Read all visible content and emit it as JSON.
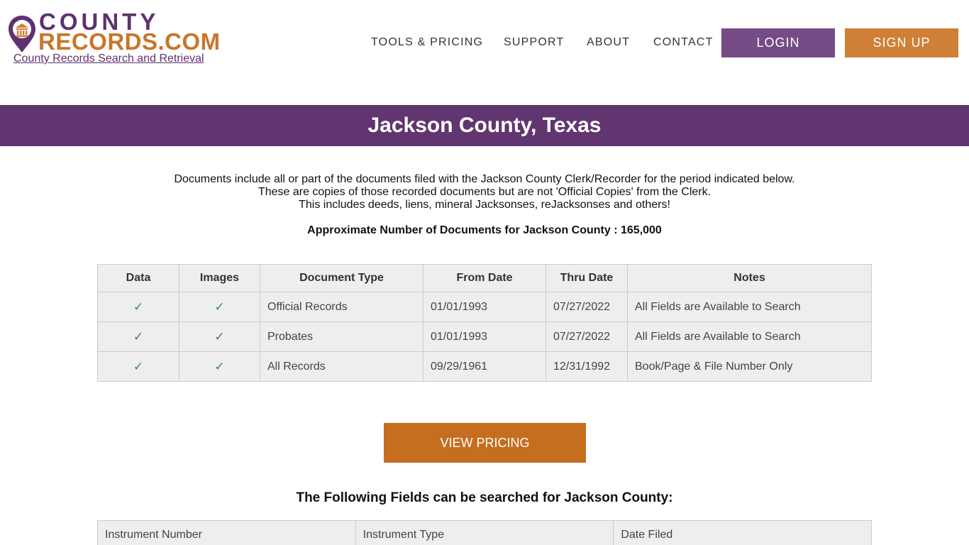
{
  "header": {
    "logo": {
      "word1": "COUNTY",
      "word2": "RECORDS.COM",
      "tagline": "County Records Search and Retrieval"
    },
    "nav": [
      {
        "label": "TOOLS & PRICING"
      },
      {
        "label": "SUPPORT"
      },
      {
        "label": "ABOUT"
      },
      {
        "label": "CONTACT"
      }
    ],
    "login_label": "LOGIN",
    "signup_label": "SIGN UP"
  },
  "colors": {
    "brand_purple": "#613570",
    "brand_orange": "#c8762a",
    "login_bg": "#764c87",
    "signup_bg": "#d07f36",
    "pricing_bg": "#c56e1f",
    "check_green": "#3c8a3c"
  },
  "banner": {
    "title": "Jackson County, Texas"
  },
  "intro": {
    "lines": [
      "Documents include all or part of the documents filed with the Jackson County Clerk/Recorder for the period indicated below.",
      "These are copies of those recorded documents but are not 'Official Copies' from the Clerk.",
      "This includes deeds, liens, mineral Jacksonses, reJacksonses and others!"
    ],
    "approx": "Approximate Number of Documents for Jackson County : 165,000"
  },
  "records_table": {
    "headers": [
      "Data",
      "Images",
      "Document Type",
      "From Date",
      "Thru Date",
      "Notes"
    ],
    "check_icon": "✓",
    "rows": [
      {
        "data": true,
        "images": true,
        "type": "Official Records",
        "from": "01/01/1993",
        "thru": "07/27/2022",
        "notes": "All Fields are Available to Search"
      },
      {
        "data": true,
        "images": true,
        "type": "Probates",
        "from": "01/01/1993",
        "thru": "07/27/2022",
        "notes": "All Fields are Available to Search"
      },
      {
        "data": true,
        "images": true,
        "type": "All Records",
        "from": "09/29/1961",
        "thru": "12/31/1992",
        "notes": "Book/Page & File Number Only"
      }
    ]
  },
  "pricing_button_label": "VIEW PRICING",
  "fields_section": {
    "title": "The Following Fields can be searched for Jackson County:",
    "fields": [
      "Instrument Number",
      "Instrument Type",
      "Date Filed"
    ]
  }
}
